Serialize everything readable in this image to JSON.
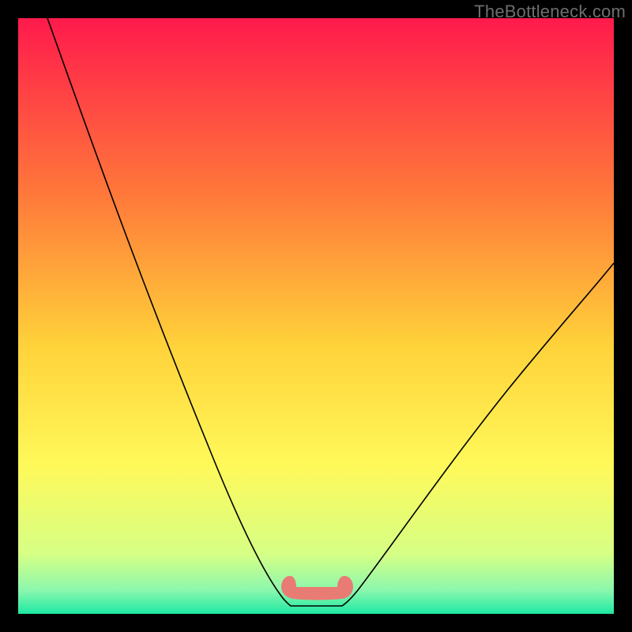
{
  "watermark": "TheBottleneck.com",
  "chart_data": {
    "type": "line",
    "title": "",
    "xlabel": "",
    "ylabel": "",
    "xlim": [
      0,
      100
    ],
    "ylim": [
      0,
      100
    ],
    "background": {
      "type": "vertical-gradient",
      "stops": [
        {
          "pct": 0,
          "color": "#ff1a4c"
        },
        {
          "pct": 30,
          "color": "#ff7a3a"
        },
        {
          "pct": 55,
          "color": "#ffd23a"
        },
        {
          "pct": 75,
          "color": "#fff95a"
        },
        {
          "pct": 90,
          "color": "#d6ff85"
        },
        {
          "pct": 96,
          "color": "#8cf7ad"
        },
        {
          "pct": 100,
          "color": "#1de9a3"
        }
      ]
    },
    "series": [
      {
        "name": "curve",
        "stroke": "#000000",
        "stroke_width": 1.5,
        "points": [
          {
            "x": 5,
            "y": 100
          },
          {
            "x": 12,
            "y": 78
          },
          {
            "x": 20,
            "y": 56
          },
          {
            "x": 28,
            "y": 35
          },
          {
            "x": 34,
            "y": 20
          },
          {
            "x": 40,
            "y": 8
          },
          {
            "x": 44,
            "y": 2
          },
          {
            "x": 46,
            "y": 0.5
          },
          {
            "x": 50,
            "y": 0.3
          },
          {
            "x": 54,
            "y": 0.5
          },
          {
            "x": 56,
            "y": 2
          },
          {
            "x": 60,
            "y": 6
          },
          {
            "x": 66,
            "y": 15
          },
          {
            "x": 74,
            "y": 28
          },
          {
            "x": 84,
            "y": 42
          },
          {
            "x": 94,
            "y": 55
          },
          {
            "x": 100,
            "y": 62
          }
        ]
      },
      {
        "name": "bottom-blob",
        "type": "area",
        "fill": "#e97b75",
        "points": [
          {
            "x": 44,
            "y": 5
          },
          {
            "x": 45,
            "y": 3
          },
          {
            "x": 47,
            "y": 1.5
          },
          {
            "x": 50,
            "y": 1.2
          },
          {
            "x": 53,
            "y": 1.5
          },
          {
            "x": 55,
            "y": 3
          },
          {
            "x": 56,
            "y": 5
          },
          {
            "x": 55,
            "y": 0.8
          },
          {
            "x": 50,
            "y": 0.5
          },
          {
            "x": 45,
            "y": 0.8
          }
        ]
      }
    ]
  }
}
